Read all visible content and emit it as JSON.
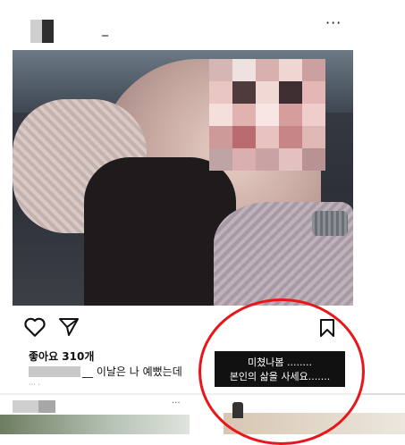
{
  "post": {
    "username_suffix": "_",
    "likes": "좋아요 310개",
    "caption": "__ 이날은 나 예뻤는데",
    "meta": "··· ·",
    "menu_glyph": "···"
  },
  "overlay": {
    "line1": "미쳤나봄 ........",
    "line2": "본인의 삶을 사세요.......",
    "circle_color": "#e8161b"
  },
  "next_post": {
    "menu_glyph": "···"
  },
  "icons": [
    "heart-icon",
    "share-icon",
    "bookmark-icon",
    "more-icon"
  ]
}
